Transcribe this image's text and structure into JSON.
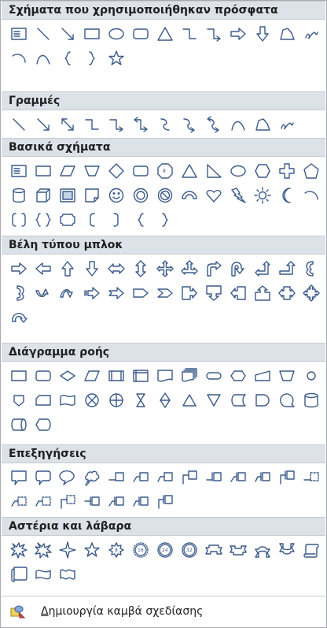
{
  "sections": [
    {
      "id": "recent",
      "title": "Σχήματα που χρησιμοποιήθηκαν πρόσφατα"
    },
    {
      "id": "lines",
      "title": "Γραμμές"
    },
    {
      "id": "basic",
      "title": "Βασικά σχήματα"
    },
    {
      "id": "block-arrows",
      "title": "Βέλη τύπου μπλοκ"
    },
    {
      "id": "flowchart",
      "title": "Διάγραμμα ροής"
    },
    {
      "id": "callouts",
      "title": "Επεξηγήσεις"
    },
    {
      "id": "stars",
      "title": "Αστέρια και λάβαρα"
    }
  ],
  "footer": {
    "label_first_letter": "Δ",
    "label_rest": "ημιουργία καμβά σχεδίασης",
    "icon": "drawing-canvas-icon"
  },
  "colors": {
    "header_bg": "#dde1e8",
    "icon_stroke": "#3b5a8a",
    "border": "#a7abb0"
  }
}
